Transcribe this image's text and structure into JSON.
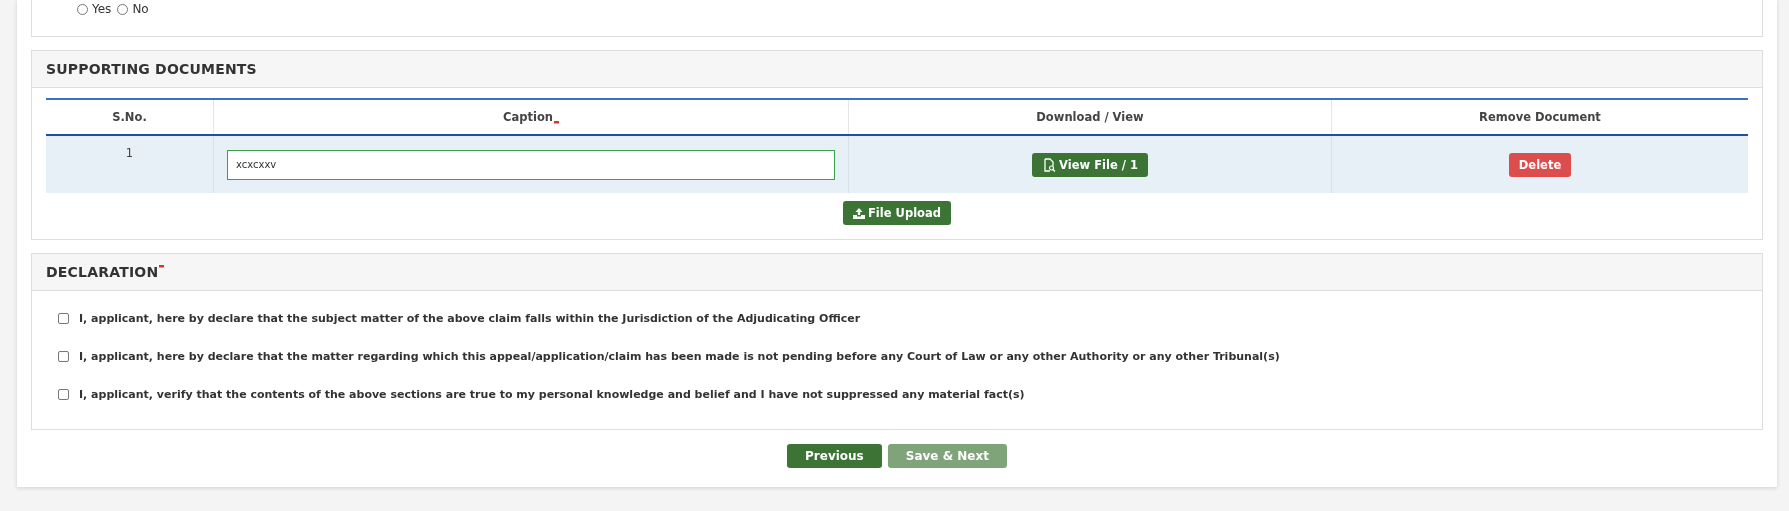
{
  "top_radio": {
    "options": [
      {
        "label": "Yes",
        "selected": false
      },
      {
        "label": "No",
        "selected": false
      }
    ]
  },
  "supporting_documents": {
    "title": "SUPPORTING DOCUMENTS",
    "columns": [
      {
        "label": "S.No.",
        "required": false
      },
      {
        "label": "Caption",
        "required": true
      },
      {
        "label": "Download / View",
        "required": false
      },
      {
        "label": "Remove Document",
        "required": false
      }
    ],
    "rows": [
      {
        "sno": "1",
        "caption": "xcxcxxv",
        "view_button": "View File / 1",
        "delete_button": "Delete"
      }
    ],
    "upload_button": "File Upload"
  },
  "declaration": {
    "title": "DECLARATION",
    "required": true,
    "items": [
      {
        "text": "I, applicant, here by declare that the subject matter of the above claim falls within the Jurisdiction of the Adjudicating Officer",
        "checked": false
      },
      {
        "text": "I, applicant, here by declare that the matter regarding which this appeal/application/claim has been made is not pending before any Court of Law or any other Authority or any other Tribunal(s)",
        "checked": false
      },
      {
        "text": "I, applicant, verify that the contents of the above sections are true to my personal knowledge and belief and I have not suppressed any material fact(s)",
        "checked": false
      }
    ]
  },
  "buttons": [
    {
      "label": "Previous",
      "disabled": false
    },
    {
      "label": "Save & Next",
      "disabled": true
    }
  ]
}
